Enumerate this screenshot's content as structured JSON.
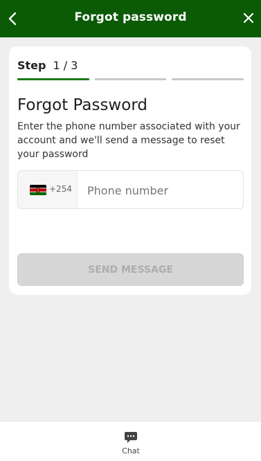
{
  "header": {
    "title": "Forgot password",
    "back_icon": "chevron-left-icon",
    "close_icon": "close-icon",
    "background": "#0b5a06"
  },
  "steps": {
    "label": "Step",
    "count": "1 / 3",
    "current": 1,
    "total": 3,
    "active_color": "#1d7a1a"
  },
  "form": {
    "heading": "Forgot Password",
    "description": "Enter the phone number associated with your account and we'll send a message to reset your password",
    "country_flag_icon": "kenya-flag-icon",
    "dial_code": "+254",
    "phone_placeholder": "Phone number",
    "phone_value": "",
    "submit_label": "SEND MESSAGE",
    "submit_enabled": false
  },
  "bottom_nav": {
    "chat_label": "Chat",
    "chat_icon": "chat-bubble-icon"
  }
}
